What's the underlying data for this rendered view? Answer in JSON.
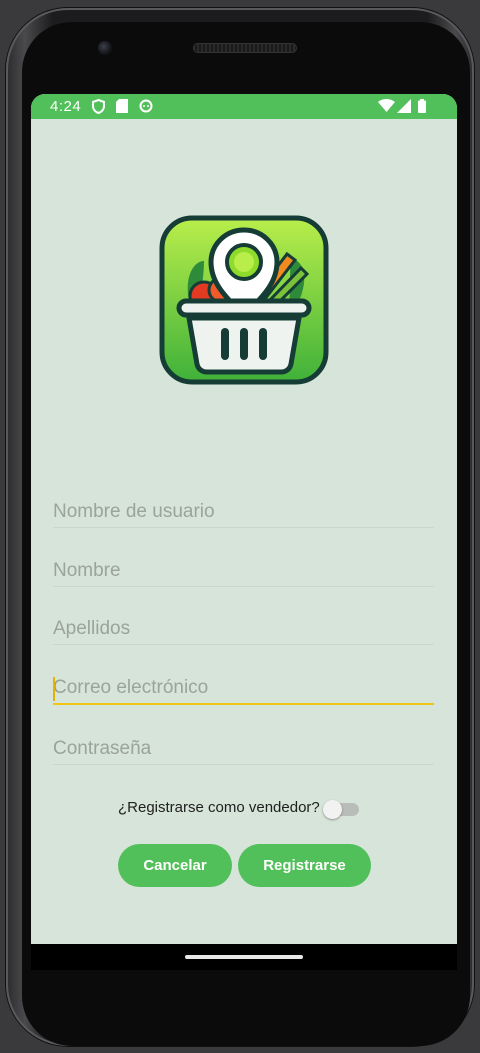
{
  "status_bar": {
    "time": "4:24",
    "left_icons": [
      "shield-icon",
      "sd-card-icon",
      "android-icon"
    ],
    "right_icons": [
      "wifi-icon",
      "signal-icon",
      "battery-icon"
    ],
    "color": "#52c05a"
  },
  "form": {
    "username_placeholder": "Nombre de usuario",
    "first_name_placeholder": "Nombre",
    "last_name_placeholder": "Apellidos",
    "email_placeholder": "Correo electrónico",
    "password_placeholder": "Contraseña",
    "focused_field": "email"
  },
  "seller_switch": {
    "label": "¿Registrarse como vendedor?",
    "checked": false
  },
  "buttons": {
    "cancel_label": "Cancelar",
    "register_label": "Registrarse"
  },
  "theme": {
    "accent": "#52c05a",
    "background": "#d7e4d9",
    "focus_underline": "#f2c614"
  }
}
